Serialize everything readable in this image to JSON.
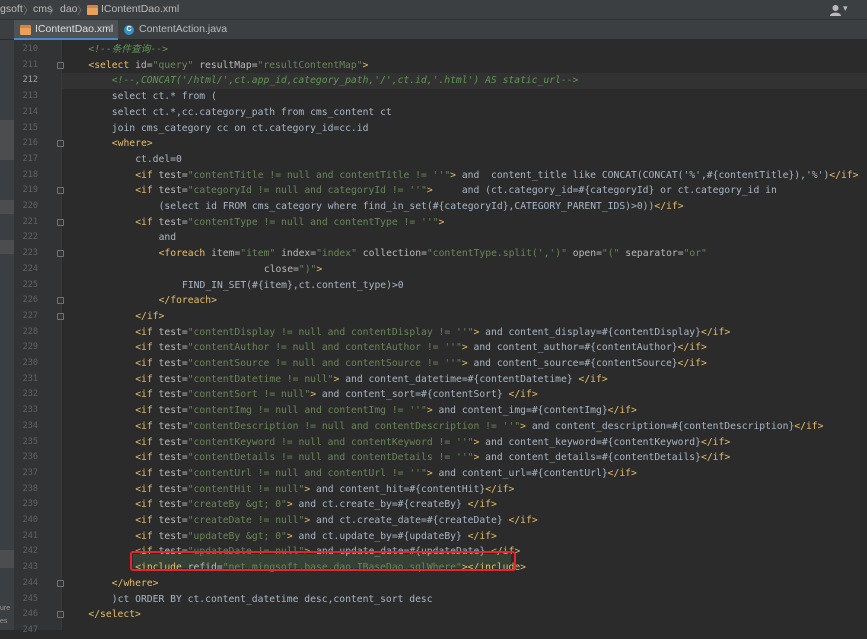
{
  "breadcrumb": {
    "items": [
      "gsoft",
      "cms",
      "dao",
      "IContentDao.xml"
    ],
    "separator": "〉"
  },
  "tabs": [
    {
      "label": "IContentDao.xml",
      "icon": "xml-file-icon",
      "active": true
    },
    {
      "label": "ContentAction.java",
      "icon": "java-class-icon",
      "active": false
    }
  ],
  "side_strip": [
    "ure",
    "es"
  ],
  "editor": {
    "current_line": 212,
    "lines": [
      {
        "num": 210,
        "indent": 2,
        "segs": [
          [
            "cm",
            "<!--条件查询-->"
          ]
        ]
      },
      {
        "num": 211,
        "indent": 2,
        "fold": true,
        "segs": [
          [
            "tg",
            "<select "
          ],
          [
            "at",
            "id="
          ],
          [
            "sv",
            "\"query\""
          ],
          [
            "at",
            " resultMap="
          ],
          [
            "sv",
            "\"resultContentMap\""
          ],
          [
            "tg",
            ">"
          ]
        ]
      },
      {
        "num": 212,
        "indent": 4,
        "segs": [
          [
            "cm",
            "<!--,CONCAT('/html/',ct.app_id,category_path,'/',ct.id,'.html') AS static_url-->"
          ]
        ]
      },
      {
        "num": 213,
        "indent": 4,
        "segs": [
          [
            "tx",
            "select ct.* from ("
          ]
        ]
      },
      {
        "num": 214,
        "indent": 4,
        "segs": [
          [
            "tx",
            "select ct.*,cc.category_path from cms_content ct"
          ]
        ]
      },
      {
        "num": 215,
        "indent": 4,
        "segs": [
          [
            "tx",
            "join cms_category cc on ct.category_id=cc.id"
          ]
        ]
      },
      {
        "num": 216,
        "indent": 4,
        "fold": true,
        "segs": [
          [
            "tg",
            "<where>"
          ]
        ]
      },
      {
        "num": 217,
        "indent": 6,
        "segs": [
          [
            "tx",
            "ct.del=0"
          ]
        ]
      },
      {
        "num": 218,
        "indent": 6,
        "segs": [
          [
            "tg",
            "<if "
          ],
          [
            "at",
            "test="
          ],
          [
            "sv",
            "\"contentTitle != null and contentTitle != ''\""
          ],
          [
            "tg",
            ">"
          ],
          [
            "tx",
            " and  content_title like CONCAT(CONCAT('%',#{contentTitle}),'%')"
          ],
          [
            "tg",
            "</if>"
          ]
        ]
      },
      {
        "num": 219,
        "indent": 6,
        "fold": true,
        "segs": [
          [
            "tg",
            "<if "
          ],
          [
            "at",
            "test="
          ],
          [
            "sv",
            "\"categoryId != null and categoryId != ''\""
          ],
          [
            "tg",
            ">"
          ],
          [
            "tx",
            "     and (ct.category_id=#{categoryId} or ct.category_id in"
          ]
        ]
      },
      {
        "num": 220,
        "indent": 8,
        "segs": [
          [
            "tx",
            "(select id FROM cms_category where find_in_set(#{categoryId},CATEGORY_PARENT_IDS)>0))"
          ],
          [
            "tg",
            "</if>"
          ]
        ]
      },
      {
        "num": 221,
        "indent": 6,
        "fold": true,
        "segs": [
          [
            "tg",
            "<if "
          ],
          [
            "at",
            "test="
          ],
          [
            "sv",
            "\"contentType != null and contentType != ''\""
          ],
          [
            "tg",
            ">"
          ]
        ]
      },
      {
        "num": 222,
        "indent": 8,
        "segs": [
          [
            "tx",
            "and"
          ]
        ]
      },
      {
        "num": 223,
        "indent": 8,
        "fold": true,
        "segs": [
          [
            "tg",
            "<foreach "
          ],
          [
            "at",
            "item="
          ],
          [
            "sv",
            "\"item\""
          ],
          [
            "at",
            " index="
          ],
          [
            "sv",
            "\"index\""
          ],
          [
            "at",
            " collection="
          ],
          [
            "sv",
            "\"contentType.split(',')\""
          ],
          [
            "at",
            " open="
          ],
          [
            "sv",
            "\"(\""
          ],
          [
            "at",
            " separator="
          ],
          [
            "sv",
            "\"or\""
          ]
        ]
      },
      {
        "num": 224,
        "indent": 17,
        "segs": [
          [
            "at",
            "close="
          ],
          [
            "sv",
            "\")\""
          ],
          [
            "tg",
            ">"
          ]
        ]
      },
      {
        "num": 225,
        "indent": 10,
        "segs": [
          [
            "tx",
            "FIND_IN_SET(#{item},ct.content_type)>0"
          ]
        ]
      },
      {
        "num": 226,
        "indent": 8,
        "fold": true,
        "segs": [
          [
            "tg",
            "</foreach>"
          ]
        ]
      },
      {
        "num": 227,
        "indent": 6,
        "fold": true,
        "segs": [
          [
            "tg",
            "</if>"
          ]
        ]
      },
      {
        "num": 228,
        "indent": 6,
        "segs": [
          [
            "tg",
            "<if "
          ],
          [
            "at",
            "test="
          ],
          [
            "sv",
            "\"contentDisplay != null and contentDisplay != ''\""
          ],
          [
            "tg",
            ">"
          ],
          [
            "tx",
            " and content_display=#{contentDisplay}"
          ],
          [
            "tg",
            "</if>"
          ]
        ]
      },
      {
        "num": 229,
        "indent": 6,
        "segs": [
          [
            "tg",
            "<if "
          ],
          [
            "at",
            "test="
          ],
          [
            "sv",
            "\"contentAuthor != null and contentAuthor != ''\""
          ],
          [
            "tg",
            ">"
          ],
          [
            "tx",
            " and content_author=#{contentAuthor}"
          ],
          [
            "tg",
            "</if>"
          ]
        ]
      },
      {
        "num": 230,
        "indent": 6,
        "segs": [
          [
            "tg",
            "<if "
          ],
          [
            "at",
            "test="
          ],
          [
            "sv",
            "\"contentSource != null and contentSource != ''\""
          ],
          [
            "tg",
            ">"
          ],
          [
            "tx",
            " and content_source=#{contentSource}"
          ],
          [
            "tg",
            "</if>"
          ]
        ]
      },
      {
        "num": 231,
        "indent": 6,
        "segs": [
          [
            "tg",
            "<if "
          ],
          [
            "at",
            "test="
          ],
          [
            "sv",
            "\"contentDatetime != null\""
          ],
          [
            "tg",
            ">"
          ],
          [
            "tx",
            " and content_datetime=#{contentDatetime} "
          ],
          [
            "tg",
            "</if>"
          ]
        ]
      },
      {
        "num": 232,
        "indent": 6,
        "segs": [
          [
            "tg",
            "<if "
          ],
          [
            "at",
            "test="
          ],
          [
            "sv",
            "\"contentSort != null\""
          ],
          [
            "tg",
            ">"
          ],
          [
            "tx",
            " and content_sort=#{contentSort} "
          ],
          [
            "tg",
            "</if>"
          ]
        ]
      },
      {
        "num": 233,
        "indent": 6,
        "segs": [
          [
            "tg",
            "<if "
          ],
          [
            "at",
            "test="
          ],
          [
            "sv",
            "\"contentImg != null and contentImg != ''\""
          ],
          [
            "tg",
            ">"
          ],
          [
            "tx",
            " and content_img=#{contentImg}"
          ],
          [
            "tg",
            "</if>"
          ]
        ]
      },
      {
        "num": 234,
        "indent": 6,
        "segs": [
          [
            "tg",
            "<if "
          ],
          [
            "at",
            "test="
          ],
          [
            "sv",
            "\"contentDescription != null and contentDescription != ''\""
          ],
          [
            "tg",
            ">"
          ],
          [
            "tx",
            " and content_description=#{contentDescription}"
          ],
          [
            "tg",
            "</if>"
          ]
        ]
      },
      {
        "num": 235,
        "indent": 6,
        "segs": [
          [
            "tg",
            "<if "
          ],
          [
            "at",
            "test="
          ],
          [
            "sv",
            "\"contentKeyword != null and contentKeyword != ''\""
          ],
          [
            "tg",
            ">"
          ],
          [
            "tx",
            " and content_keyword=#{contentKeyword}"
          ],
          [
            "tg",
            "</if>"
          ]
        ]
      },
      {
        "num": 236,
        "indent": 6,
        "segs": [
          [
            "tg",
            "<if "
          ],
          [
            "at",
            "test="
          ],
          [
            "sv",
            "\"contentDetails != null and contentDetails != ''\""
          ],
          [
            "tg",
            ">"
          ],
          [
            "tx",
            " and content_details=#{contentDetails}"
          ],
          [
            "tg",
            "</if>"
          ]
        ]
      },
      {
        "num": 237,
        "indent": 6,
        "segs": [
          [
            "tg",
            "<if "
          ],
          [
            "at",
            "test="
          ],
          [
            "sv",
            "\"contentUrl != null and contentUrl != ''\""
          ],
          [
            "tg",
            ">"
          ],
          [
            "tx",
            " and content_url=#{contentUrl}"
          ],
          [
            "tg",
            "</if>"
          ]
        ]
      },
      {
        "num": 238,
        "indent": 6,
        "segs": [
          [
            "tg",
            "<if "
          ],
          [
            "at",
            "test="
          ],
          [
            "sv",
            "\"contentHit != null\""
          ],
          [
            "tg",
            ">"
          ],
          [
            "tx",
            " and content_hit=#{contentHit}"
          ],
          [
            "tg",
            "</if>"
          ]
        ]
      },
      {
        "num": 239,
        "indent": 6,
        "segs": [
          [
            "tg",
            "<if "
          ],
          [
            "at",
            "test="
          ],
          [
            "sv",
            "\"createBy &gt; 0\""
          ],
          [
            "tg",
            ">"
          ],
          [
            "tx",
            " and ct.create_by=#{createBy} "
          ],
          [
            "tg",
            "</if>"
          ]
        ]
      },
      {
        "num": 240,
        "indent": 6,
        "segs": [
          [
            "tg",
            "<if "
          ],
          [
            "at",
            "test="
          ],
          [
            "sv",
            "\"createDate != null\""
          ],
          [
            "tg",
            ">"
          ],
          [
            "tx",
            " and ct.create_date=#{createDate} "
          ],
          [
            "tg",
            "</if>"
          ]
        ]
      },
      {
        "num": 241,
        "indent": 6,
        "segs": [
          [
            "tg",
            "<if "
          ],
          [
            "at",
            "test="
          ],
          [
            "sv",
            "\"updateBy &gt; 0\""
          ],
          [
            "tg",
            ">"
          ],
          [
            "tx",
            " and ct.update_by=#{updateBy} "
          ],
          [
            "tg",
            "</if>"
          ]
        ]
      },
      {
        "num": 242,
        "indent": 6,
        "segs": [
          [
            "tg",
            "<if "
          ],
          [
            "at",
            "test="
          ],
          [
            "sv",
            "\"updateDate != null\""
          ],
          [
            "tg",
            ">"
          ],
          [
            "tx",
            " and update_date=#{updateDate} "
          ],
          [
            "tg",
            "</if>"
          ]
        ]
      },
      {
        "num": 243,
        "indent": 6,
        "highlight": true,
        "segs": [
          [
            "tg",
            "<include "
          ],
          [
            "at",
            "refid="
          ],
          [
            "sv",
            "\"net.mingsoft.base.dao.IBaseDao.sqlWhere\""
          ],
          [
            "tg",
            "></include>"
          ]
        ]
      },
      {
        "num": 244,
        "indent": 4,
        "fold": true,
        "segs": [
          [
            "tg",
            "</where>"
          ]
        ]
      },
      {
        "num": 245,
        "indent": 4,
        "segs": [
          [
            "tx",
            ")ct ORDER BY ct.content_datetime desc,content_sort desc"
          ]
        ]
      },
      {
        "num": 246,
        "indent": 2,
        "fold": true,
        "segs": [
          [
            "tg",
            "</select>"
          ]
        ]
      },
      {
        "num": 247,
        "indent": 0,
        "segs": []
      }
    ]
  },
  "colors": {
    "background": "#2b2b2b",
    "tag": "#e8bf6a",
    "attribute": "#bababa",
    "string": "#6a8759",
    "comment": "#629755",
    "highlight_border": "#e3262b"
  }
}
